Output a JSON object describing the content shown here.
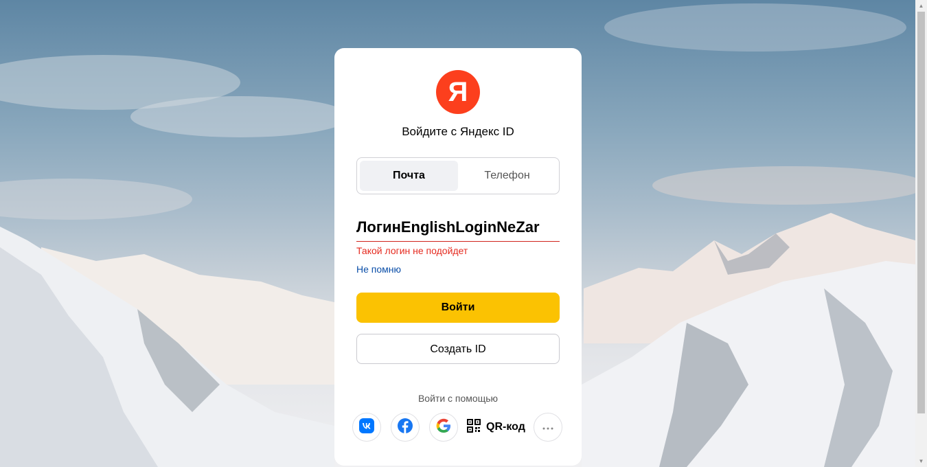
{
  "page": {
    "logo_letter": "Я",
    "title": "Войдите с Яндекс ID"
  },
  "tabs": [
    {
      "label": "Почта",
      "active": true
    },
    {
      "label": "Телефон",
      "active": false
    }
  ],
  "login": {
    "value": "ЛогинEnglishLoginNeZamenit",
    "visible_value": "ЛогинEnglishLoginNeZar",
    "error": "Такой логин не подойдет",
    "forgot_link": "Не помню"
  },
  "buttons": {
    "submit": "Войти",
    "create": "Создать ID"
  },
  "social": {
    "label": "Войти с помощью",
    "providers": [
      {
        "name": "vk",
        "icon": "vk-icon"
      },
      {
        "name": "facebook",
        "icon": "facebook-icon"
      },
      {
        "name": "google",
        "icon": "google-icon"
      },
      {
        "name": "qr",
        "icon": "qr-code-icon",
        "label": "QR-код"
      },
      {
        "name": "more",
        "icon": "more-icon"
      }
    ]
  },
  "colors": {
    "brand_red": "#fc3f1d",
    "primary_yellow": "#fbc202",
    "error_red": "#e52a1f",
    "link_blue": "#0a4ea8"
  }
}
